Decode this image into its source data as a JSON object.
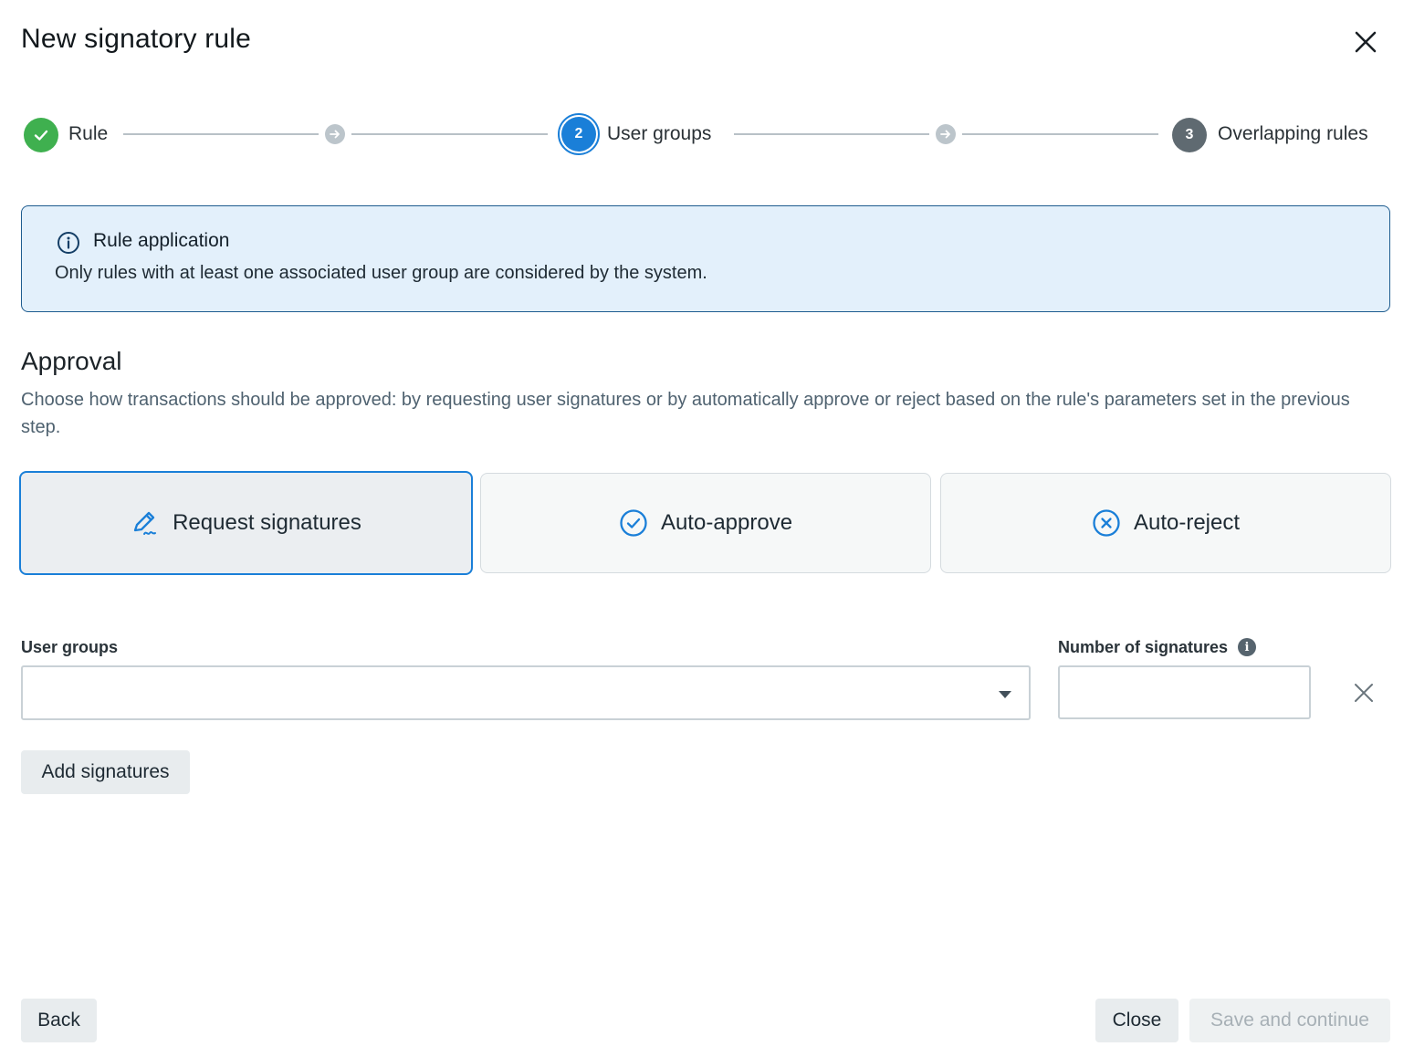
{
  "dialog": {
    "title": "New signatory rule",
    "close_icon": "close-icon"
  },
  "stepper": {
    "steps": [
      {
        "label": "Rule",
        "state": "completed",
        "icon": "check-icon"
      },
      {
        "label": "User groups",
        "state": "active",
        "number": "2"
      },
      {
        "label": "Overlapping rules",
        "state": "pending",
        "number": "3"
      }
    ],
    "connector_icon": "arrow-right-icon"
  },
  "banner": {
    "icon": "info-icon",
    "title": "Rule application",
    "text": "Only rules with at least one associated user group are considered by the system."
  },
  "approval": {
    "title": "Approval",
    "description": "Choose how transactions should be approved: by requesting user signatures or by automatically approve or reject based on the rule's parameters set in the previous step.",
    "options": [
      {
        "label": "Request signatures",
        "icon": "pen-signature-icon",
        "selected": true
      },
      {
        "label": "Auto-approve",
        "icon": "check-circle-icon",
        "selected": false
      },
      {
        "label": "Auto-reject",
        "icon": "x-circle-icon",
        "selected": false
      }
    ]
  },
  "signatures": {
    "user_groups_label": "User groups",
    "user_groups_value": "",
    "number_label": "Number of signatures",
    "number_value": "",
    "info_glyph": "i",
    "add_label": "Add signatures"
  },
  "footer": {
    "back_label": "Back",
    "close_label": "Close",
    "save_label": "Save and continue"
  },
  "colors": {
    "accent": "#1a7fd8",
    "success": "#3fb04f",
    "banner_bg": "#e3f0fb",
    "pending": "#5f6a71"
  }
}
